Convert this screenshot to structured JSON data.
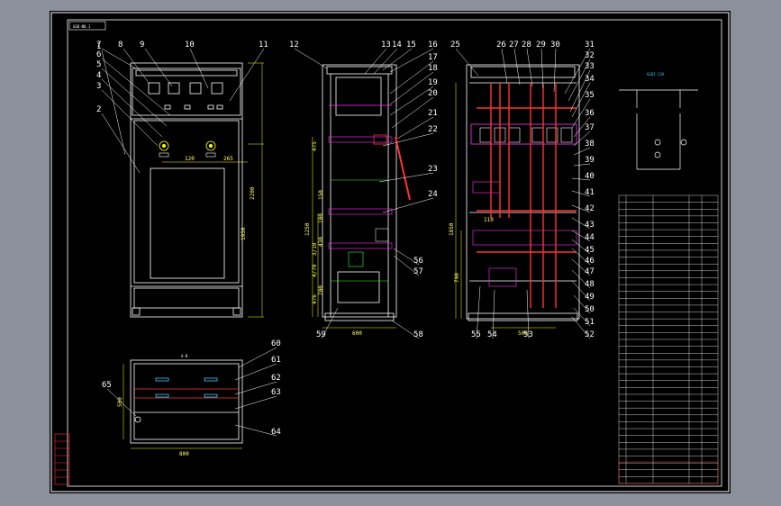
{
  "drawing": {
    "sheet_code": "GGD-NO.1",
    "top_view_label": "A-B",
    "front_title": "",
    "side_title": "",
    "right_title": "",
    "schematic_title": "",
    "schematic_subtitle": "GGD1-13A",
    "wide_dim_900": "900",
    "wide_dim_600": "600",
    "plan_dim_800": "800",
    "plan_dim_500": "500"
  },
  "callouts": [
    "1",
    "2",
    "3",
    "4",
    "5",
    "6",
    "7",
    "8",
    "9",
    "10",
    "11",
    "12",
    "13",
    "14",
    "15",
    "16",
    "17",
    "18",
    "19",
    "20",
    "21",
    "22",
    "23",
    "24",
    "25",
    "26",
    "27",
    "28",
    "29",
    "30",
    "31",
    "32",
    "33",
    "34",
    "35",
    "36",
    "37",
    "38",
    "39",
    "40",
    "41",
    "42",
    "43",
    "44",
    "45",
    "46",
    "47",
    "48",
    "49",
    "50",
    "51",
    "52",
    "53",
    "54",
    "55",
    "56",
    "57",
    "58",
    "59",
    "60",
    "61",
    "62",
    "63",
    "64",
    "65"
  ],
  "dimensions": {
    "front": [
      "120",
      "265",
      "2200",
      "1950"
    ],
    "side": [
      "1250",
      "475",
      "3/10",
      "4/70",
      "476",
      "100",
      "430",
      "150",
      "200",
      "500"
    ],
    "right": [
      "1850",
      "790",
      "110",
      "500"
    ]
  },
  "notes": [],
  "colors": {
    "background": "#000000",
    "frame": "#ffffff",
    "line": "#ffffff",
    "dimension": "#ffff00",
    "busbar": "#ff3333",
    "magenta": "#ff33ff",
    "green": "#33ff33",
    "cyan": "#33ccff"
  }
}
